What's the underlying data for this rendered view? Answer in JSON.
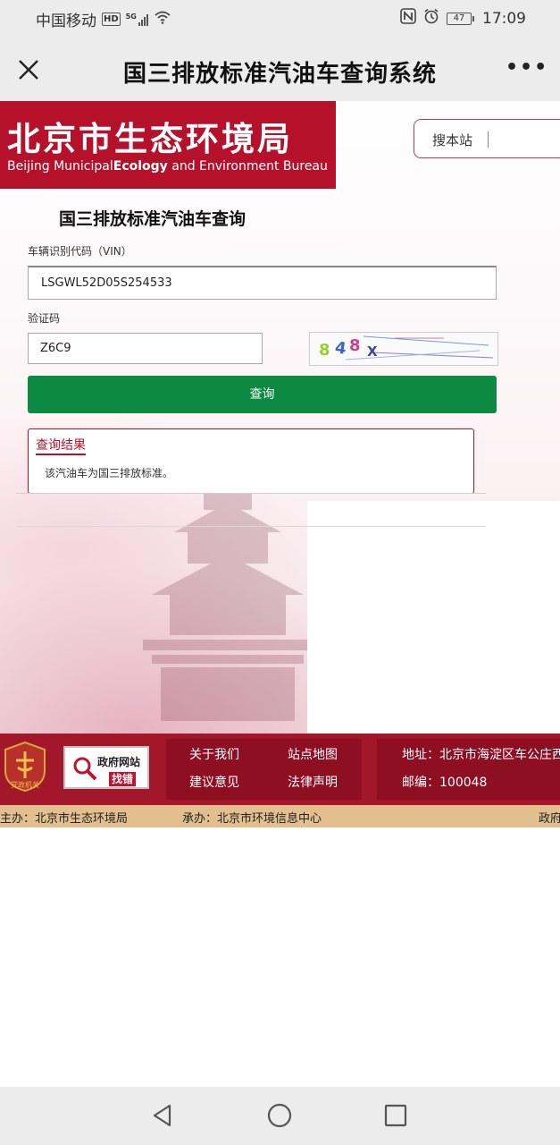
{
  "status_bar": {
    "carrier": "中国移动",
    "network_badge": "HD",
    "signal_type": "5G",
    "battery": "47",
    "time": "17:09"
  },
  "title_bar": {
    "title": "国三排放标准汽油车查询系统",
    "more_label": "•••"
  },
  "header": {
    "logo_cn": "北京市生态环境局",
    "logo_en_1": "Beijing Municipal",
    "logo_en_2": "Ecology",
    "logo_en_3": " and Environment Bureau",
    "search_label": "搜本站"
  },
  "form": {
    "title": "国三排放标准汽油车查询",
    "vin_label": "车辆识别代码（VIN）",
    "vin_value": "LSGWL52D05S254533",
    "captcha_label": "验证码",
    "captcha_value": "Z6C9",
    "captcha_image_chars": [
      "8",
      "4",
      "8",
      "X"
    ],
    "query_button": "查询"
  },
  "result": {
    "title": "查询结果",
    "text": "该汽油车为国三排放标准。"
  },
  "footer": {
    "party_label": "党政机关",
    "gov_site_top": "政府网站",
    "gov_site_bottom": "找错",
    "links": [
      "关于我们",
      "站点地图",
      "建议意见",
      "法律声明"
    ],
    "address": "地址：北京市海淀区车公庄西",
    "zip": "邮编：100048",
    "sponsor": "主办：北京市生态环境局",
    "organizer": "承办：北京市环境信息中心",
    "cut_text": "政府"
  },
  "colors": {
    "brand_red": "#b5112b",
    "footer_red": "#a3172b",
    "button_green": "#0d8a42",
    "sponsor_bar": "#e3bf8f"
  }
}
